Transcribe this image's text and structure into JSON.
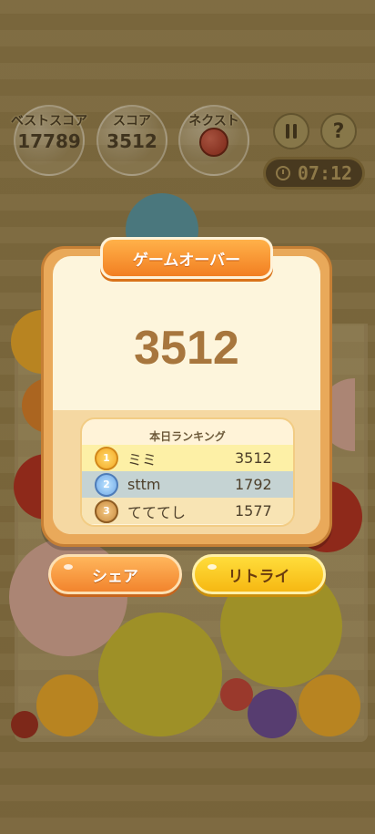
{
  "hud": {
    "best_score_label": "ベストスコア",
    "best_score_value": "17789",
    "score_label": "スコア",
    "score_value": "3512",
    "next_label": "ネクスト",
    "next_fruit_icon": "cherry-icon",
    "pause_icon": "pause-icon",
    "help_label": "?",
    "timer": "07:12"
  },
  "dialog": {
    "title": "ゲームオーバー",
    "final_score": "3512",
    "ranking_title": "本日ランキング",
    "ranking": [
      {
        "rank": "1",
        "name": "ミミ",
        "score": "3512"
      },
      {
        "rank": "2",
        "name": "sttm",
        "score": "1792"
      },
      {
        "rank": "3",
        "name": "てててし",
        "score": "1577"
      }
    ],
    "share_label": "シェア",
    "retry_label": "リトライ"
  },
  "colors": {
    "title_banner": "#f27f22",
    "share_button": "#f2842d",
    "retry_button": "#f6b812",
    "score_text": "#a7763d"
  }
}
